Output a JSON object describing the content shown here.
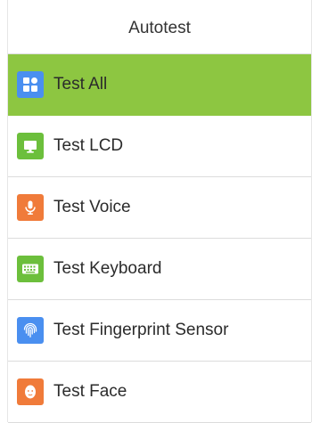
{
  "header": {
    "title": "Autotest"
  },
  "colors": {
    "selected_background": "#8dc641",
    "divider": "#dcdcdc"
  },
  "menu": {
    "items": [
      {
        "label": "Test All",
        "icon": "grid-apps-icon",
        "icon_color": "#4a8ff0",
        "selected": true
      },
      {
        "label": "Test LCD",
        "icon": "monitor-icon",
        "icon_color": "#6cbf3c",
        "selected": false
      },
      {
        "label": "Test Voice",
        "icon": "microphone-icon",
        "icon_color": "#f07b3a",
        "selected": false
      },
      {
        "label": "Test Keyboard",
        "icon": "keyboard-icon",
        "icon_color": "#6cbf3c",
        "selected": false
      },
      {
        "label": "Test Fingerprint Sensor",
        "icon": "fingerprint-icon",
        "icon_color": "#4a8ff0",
        "selected": false
      },
      {
        "label": "Test Face",
        "icon": "face-icon",
        "icon_color": "#f07b3a",
        "selected": false
      }
    ]
  }
}
